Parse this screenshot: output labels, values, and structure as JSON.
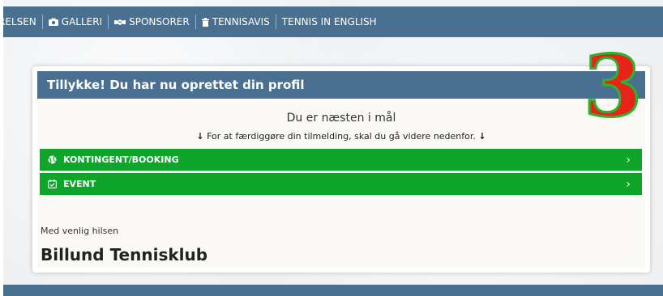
{
  "nav": {
    "items": [
      {
        "label": "RELSEN",
        "icon": ""
      },
      {
        "label": "GALLERI",
        "icon": "camera-icon"
      },
      {
        "label": "SPONSORER",
        "icon": "handshake-icon"
      },
      {
        "label": "TENNISAVIS",
        "icon": "trash-icon"
      },
      {
        "label": "TENNIS IN ENGLISH",
        "icon": ""
      }
    ]
  },
  "overlay": {
    "number": "3"
  },
  "card": {
    "title": "Tillykke! Du har nu oprettet din profil",
    "subtitle": "Du er næsten i mål",
    "instruction": "For at færdiggøre din tilmelding, skal du gå videre nedenfor.",
    "arrow": "↓",
    "buttons": [
      {
        "label": "KONTINGENT/BOOKING",
        "icon": "tennis-ball-icon",
        "chevron": "›"
      },
      {
        "label": "EVENT",
        "icon": "calendar-check-icon",
        "chevron": "›"
      }
    ],
    "closing": "Med venlig hilsen",
    "club_name": "Billund Tennisklub"
  },
  "colors": {
    "nav_bg": "#4a7091",
    "green": "#0ea52a",
    "number_fill": "#e8231a",
    "number_outline": "#2cb52c"
  }
}
